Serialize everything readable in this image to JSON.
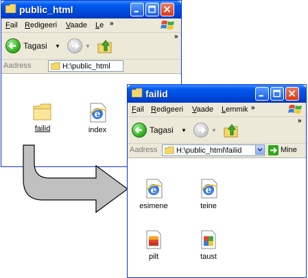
{
  "back_window": {
    "title": "public_html",
    "menu": [
      "Fail",
      "Redigeeri",
      "Vaade",
      "Le"
    ],
    "back_label": "Tagasi",
    "address_label": "Aadress",
    "address_value": "H:\\public_html",
    "items": [
      {
        "label": "failid",
        "icon": "folder-icon"
      },
      {
        "label": "index",
        "icon": "ie-html-icon"
      }
    ]
  },
  "front_window": {
    "title": "failid",
    "menu": [
      "Fail",
      "Redigeeri",
      "Vaade",
      "Lemmik"
    ],
    "back_label": "Tagasi",
    "address_label": "Aadress",
    "address_value": "H:\\public_html\\failid",
    "go_label": "Mine",
    "items": [
      {
        "label": "esimene",
        "icon": "ie-html-icon"
      },
      {
        "label": "teine",
        "icon": "ie-html-icon"
      },
      {
        "label": "pilt",
        "icon": "image-file-icon"
      },
      {
        "label": "taust",
        "icon": "image-file-icon"
      }
    ]
  },
  "colors": {
    "titlebar": "#0058ee",
    "chrome": "#ece9d8",
    "arrow": "#c0c0c0"
  }
}
